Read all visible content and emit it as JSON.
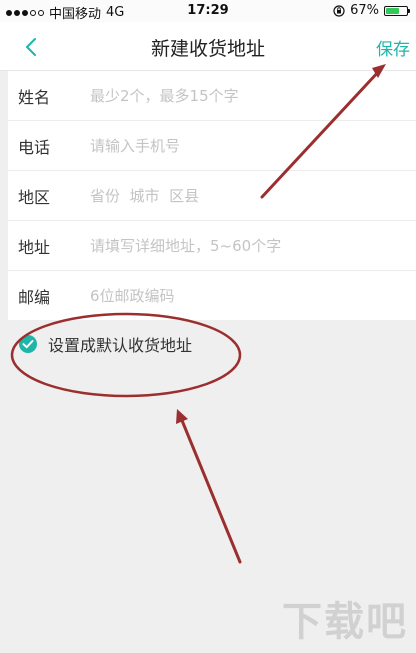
{
  "status_bar": {
    "carrier": "中国移动",
    "network": "4G",
    "time": "17:29",
    "battery": "67%",
    "battery_level": 0.67,
    "signal_bars": 3
  },
  "nav": {
    "title": "新建收货地址",
    "save_label": "保存",
    "back_icon": "chevron-left-icon"
  },
  "form": {
    "fields": [
      {
        "label": "姓名",
        "placeholder": "最少2个，最多15个字",
        "value": ""
      },
      {
        "label": "电话",
        "placeholder": "请输入手机号",
        "value": ""
      },
      {
        "label": "地区",
        "placeholder": "省份  城市  区县",
        "value": ""
      },
      {
        "label": "地址",
        "placeholder": "请填写详细地址，5~60个字",
        "value": ""
      },
      {
        "label": "邮编",
        "placeholder": "6位邮政编码",
        "value": ""
      }
    ]
  },
  "default_address": {
    "label": "设置成默认收货地址",
    "checked": true,
    "icon": "check-circle-icon"
  },
  "colors": {
    "accent": "#1fb5a8",
    "annotation": "#9b2f2f",
    "background": "#efefef"
  },
  "watermark": {
    "text": "下载吧"
  }
}
